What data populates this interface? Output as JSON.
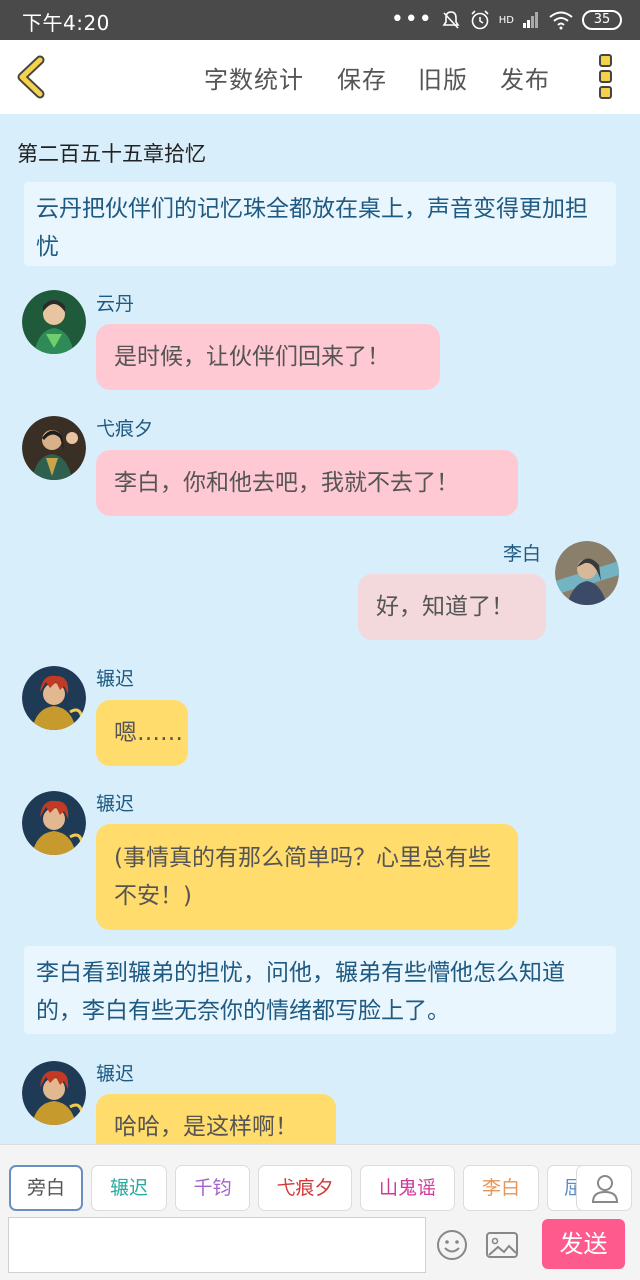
{
  "status_bar": {
    "time": "下午4:20",
    "network": "HD",
    "battery": "35"
  },
  "header": {
    "word_count": "字数统计",
    "save": "保存",
    "old_version": "旧版",
    "publish": "发布"
  },
  "chapter_title": "第二百五十五章拾忆",
  "messages": [
    {
      "type": "narration",
      "text": "云丹把伙伴们的记忆珠全都放在桌上，声音变得更加担忧"
    },
    {
      "type": "dialog",
      "speaker": "云丹",
      "text": "是时候，让伙伴们回来了！",
      "side": "left"
    },
    {
      "type": "dialog",
      "speaker": "弋痕夕",
      "text": "李白，你和他去吧，我就不去了！",
      "side": "left"
    },
    {
      "type": "dialog",
      "speaker": "李白",
      "text": "好，知道了！",
      "side": "right"
    },
    {
      "type": "dialog",
      "speaker": "辗迟",
      "text": "嗯……",
      "side": "left"
    },
    {
      "type": "dialog",
      "speaker": "辗迟",
      "text": "(事情真的有那么简单吗？心里总有些不安！)",
      "side": "left"
    },
    {
      "type": "narration",
      "text": "李白看到辗弟的担忧，问他，辗弟有些懵他怎么知道的，李白有些无奈你的情绪都写脸上了。"
    },
    {
      "type": "dialog",
      "speaker": "辗迟",
      "text": "哈哈，是这样啊！",
      "side": "left"
    }
  ],
  "characters": [
    {
      "label": "旁白",
      "color": "#555555"
    },
    {
      "label": "辗迟",
      "color": "#2aa9a0"
    },
    {
      "label": "千钧",
      "color": "#a463c9"
    },
    {
      "label": "弋痕夕",
      "color": "#d23a3a"
    },
    {
      "label": "山鬼谣",
      "color": "#d0389a"
    },
    {
      "label": "李白",
      "color": "#e6955a"
    },
    {
      "label": "屈",
      "color": "#5a8fc5"
    }
  ],
  "input": {
    "value": "",
    "placeholder": ""
  },
  "send_label": "发送",
  "icons": [
    "back-arrow-icon",
    "more-menu-icon",
    "person-icon",
    "emoji-icon",
    "image-icon"
  ]
}
